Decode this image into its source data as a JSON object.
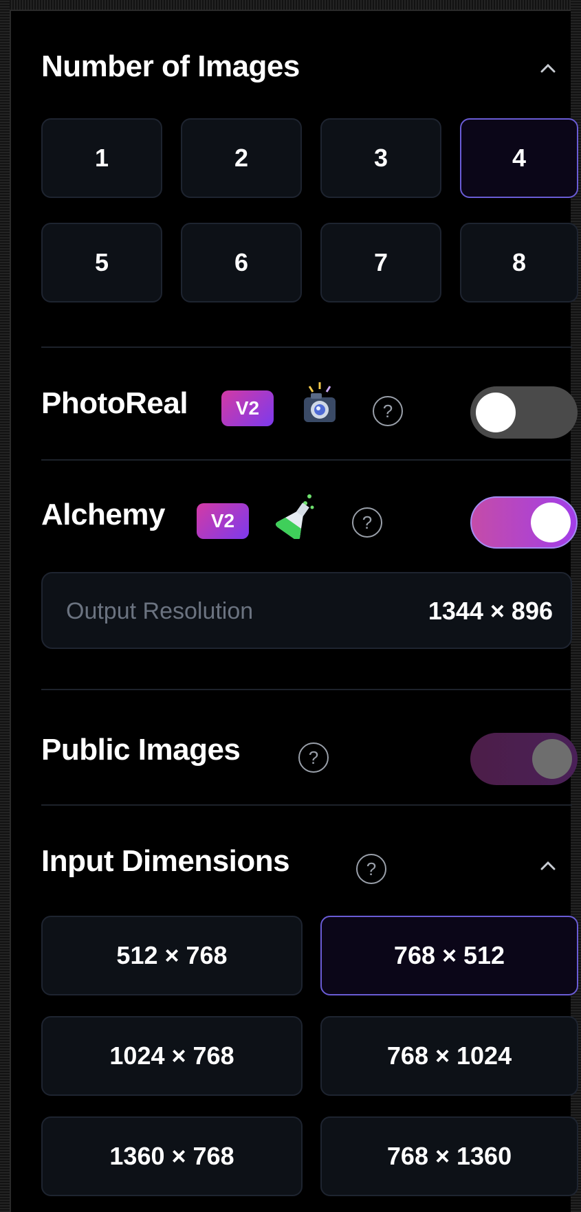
{
  "number_of_images": {
    "title": "Number of Images",
    "options": [
      "1",
      "2",
      "3",
      "4",
      "5",
      "6",
      "7",
      "8"
    ],
    "selected": "4"
  },
  "photoreal": {
    "label": "PhotoReal",
    "badge": "V2",
    "icon": "camera-sparkle-icon",
    "help": "?",
    "enabled": false
  },
  "alchemy": {
    "label": "Alchemy",
    "badge": "V2",
    "icon": "potion-flask-icon",
    "help": "?",
    "enabled": true
  },
  "output_resolution": {
    "label": "Output Resolution",
    "value": "1344 × 896"
  },
  "public_images": {
    "label": "Public Images",
    "help": "?",
    "enabled": true,
    "locked": true
  },
  "input_dimensions": {
    "title": "Input Dimensions",
    "help": "?",
    "options": [
      "512 × 768",
      "768 × 512",
      "1024 × 768",
      "768 × 1024",
      "1360 × 768",
      "768 × 1360"
    ],
    "selected": "768 × 512"
  },
  "colors": {
    "accent": "#6a5cd6",
    "badge_gradient": [
      "#d33aa4",
      "#7c3aed"
    ],
    "panel_bg": "#000000",
    "button_bg": "#0d1117"
  }
}
